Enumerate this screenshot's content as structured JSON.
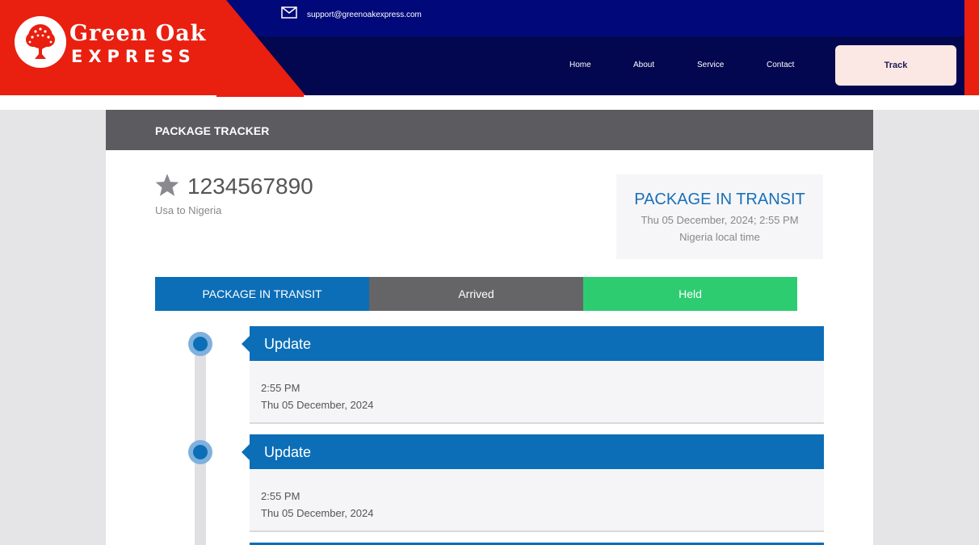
{
  "brand": {
    "name_line1": "Green Oak",
    "name_line2": "EXPRESS",
    "colors": {
      "red": "#e91f10",
      "navy": "#02074f",
      "topbar": "#01097a"
    }
  },
  "topbar": {
    "email_icon": "mail-icon",
    "email": "support@greenoakexpress.com"
  },
  "nav": {
    "home": "Home",
    "about": "About",
    "service": "Service",
    "contact": "Contact",
    "track": "Track"
  },
  "tracker": {
    "header": "PACKAGE TRACKER",
    "star_icon": "star-icon",
    "tracking_number": "1234567890",
    "route": "Usa to Nigeria",
    "status": {
      "title": "PACKAGE IN TRANSIT",
      "datetime": "Thu 05 December, 2024; 2:55 PM",
      "timezone": "Nigeria local time"
    },
    "tabs": [
      {
        "label": "PACKAGE IN TRANSIT",
        "color": "#0c6eb7"
      },
      {
        "label": "Arrived",
        "color": "#656568"
      },
      {
        "label": "Held",
        "color": "#2ecc71"
      }
    ],
    "updates": [
      {
        "title": "Update",
        "time": "2:55 PM",
        "date": "Thu 05 December, 2024"
      },
      {
        "title": "Update",
        "time": "2:55 PM",
        "date": "Thu 05 December, 2024"
      }
    ]
  }
}
